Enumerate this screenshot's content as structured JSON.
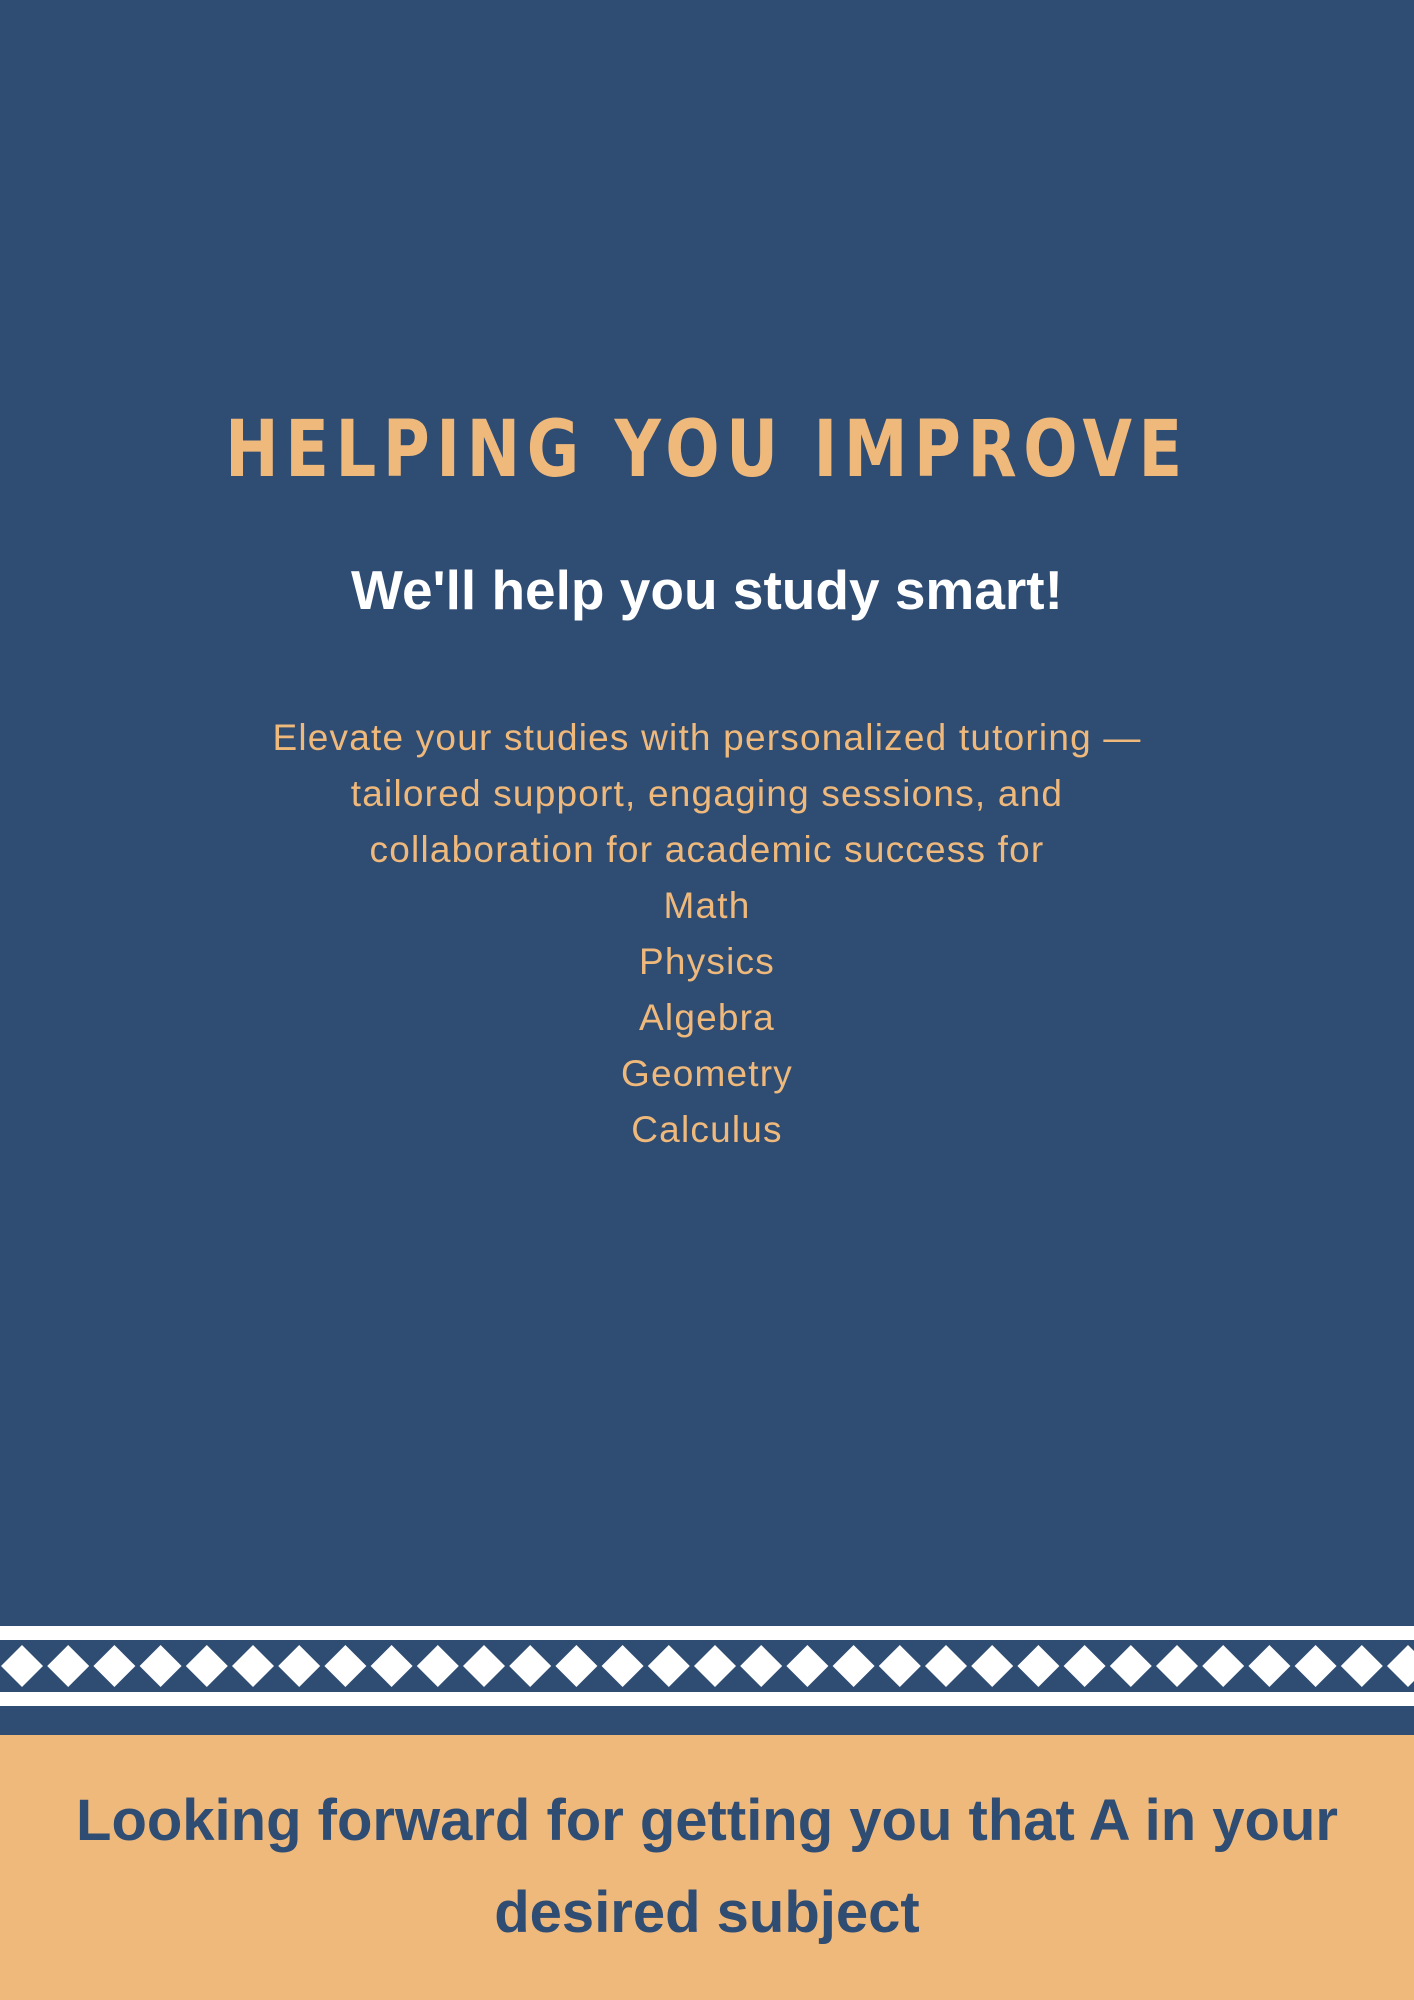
{
  "colors": {
    "background": "#2f4c73",
    "accent": "#efb97c",
    "white": "#ffffff"
  },
  "hero": {
    "title": "HELPING YOU IMPROVE",
    "subtitle": "We'll help you study smart!",
    "description": "Elevate your studies with personalized tutoring —tailored support, engaging sessions, and collaboration for academic success for",
    "subjects": [
      "Math",
      "Physics",
      "Algebra",
      "Geometry",
      "Calculus"
    ]
  },
  "decoration": {
    "pattern": "white-diamond-border"
  },
  "footer": {
    "text": "Looking forward for getting you that A in your desired subject"
  }
}
